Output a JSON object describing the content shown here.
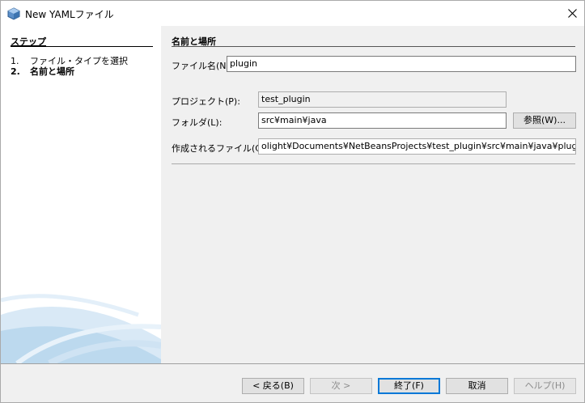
{
  "window": {
    "title": "New YAMLファイル"
  },
  "steps": {
    "title": "ステップ",
    "items": [
      {
        "num": "1.",
        "label": "ファイル・タイプを選択",
        "current": false
      },
      {
        "num": "2.",
        "label": "名前と場所",
        "current": true
      }
    ]
  },
  "main": {
    "section_title": "名前と場所",
    "filename": {
      "label": "ファイル名(N):",
      "value": "plugin"
    },
    "project": {
      "label": "プロジェクト(P):",
      "value": "test_plugin"
    },
    "folder": {
      "label": "フォルダ(L):",
      "value": "src¥main¥java",
      "browse_label": "参照(W)..."
    },
    "created_file": {
      "label": "作成されるファイル(C):",
      "value": "olight¥Documents¥NetBeansProjects¥test_plugin¥src¥main¥java¥plugin.yml"
    }
  },
  "buttons": {
    "back": "< 戻る(B)",
    "next": "次 >",
    "finish": "終了(F)",
    "cancel": "取消",
    "help": "ヘルプ(H)"
  },
  "colors": {
    "accent": "#0078d7",
    "decor": "#bcd9ee"
  }
}
